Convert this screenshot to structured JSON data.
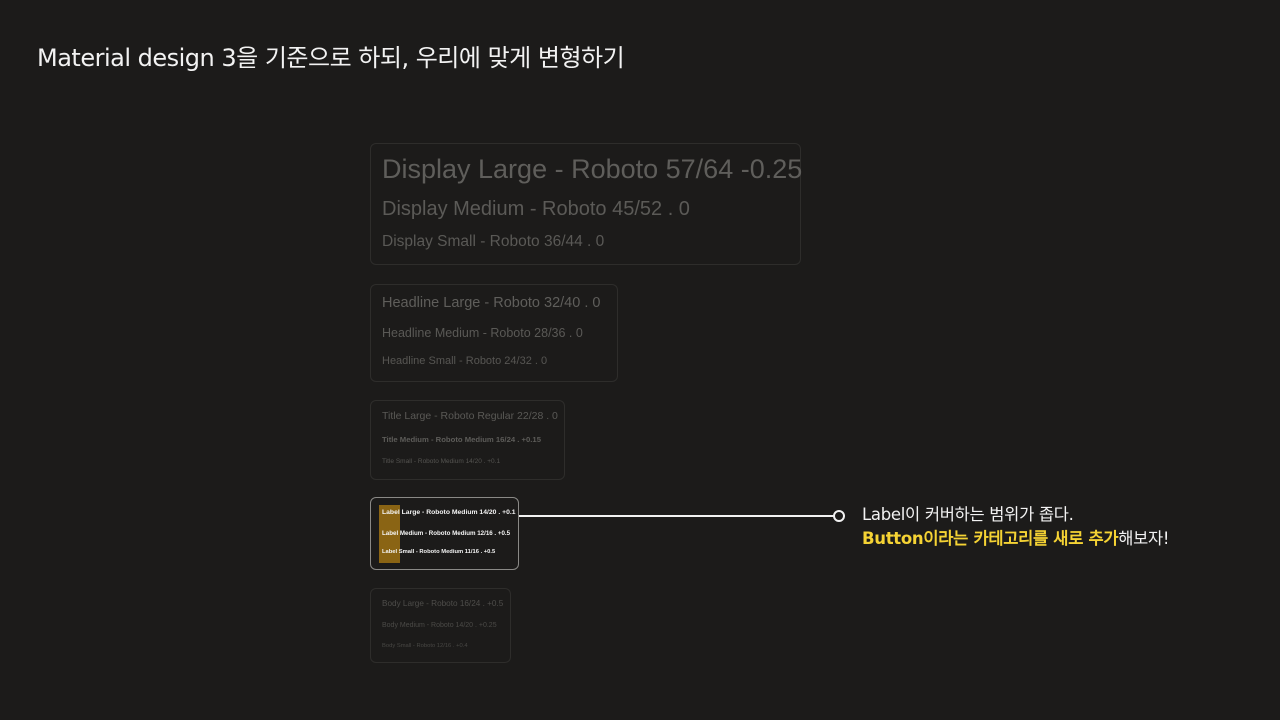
{
  "page": {
    "title": "Material design 3을 기준으로 하되, 우리에 맞게 변형하기"
  },
  "cards": {
    "display": {
      "large": "Display Large - Roboto 57/64 -0.25",
      "medium": "Display Medium - Roboto 45/52 .  0",
      "small": "Display Small - Roboto 36/44 . 0"
    },
    "headline": {
      "large": "Headline Large - Roboto 32/40 . 0",
      "medium": "Headline Medium - Roboto 28/36 . 0",
      "small": "Headline Small - Roboto 24/32 . 0"
    },
    "title": {
      "large": "Title Large - Roboto Regular 22/28 . 0",
      "medium": "Title Medium - Roboto Medium 16/24 . +0.15",
      "small": "Title Small - Roboto Medium 14/20 . +0.1"
    },
    "label": {
      "large": "Label Large - Roboto Medium 14/20 . +0.1",
      "medium": "Label Medium - Roboto Medium 12/16 . +0.5",
      "small": "Label Small - Roboto Medium 11/16 . +0.5"
    },
    "body": {
      "large": "Body Large - Roboto 16/24 . +0.5",
      "medium": "Body Medium - Roboto 14/20 . +0.25",
      "small": "Body Small - Roboto 12/16 . +0.4"
    }
  },
  "note": {
    "line1": "Label이 커버하는 범위가 좁다.",
    "line2_accent": "Button이라는 카테고리를 새로 추가",
    "line2_rest": "해보자!"
  },
  "colors": {
    "background": "#1c1b1a",
    "highlight": "#8a6414",
    "accent": "#f5d334"
  }
}
